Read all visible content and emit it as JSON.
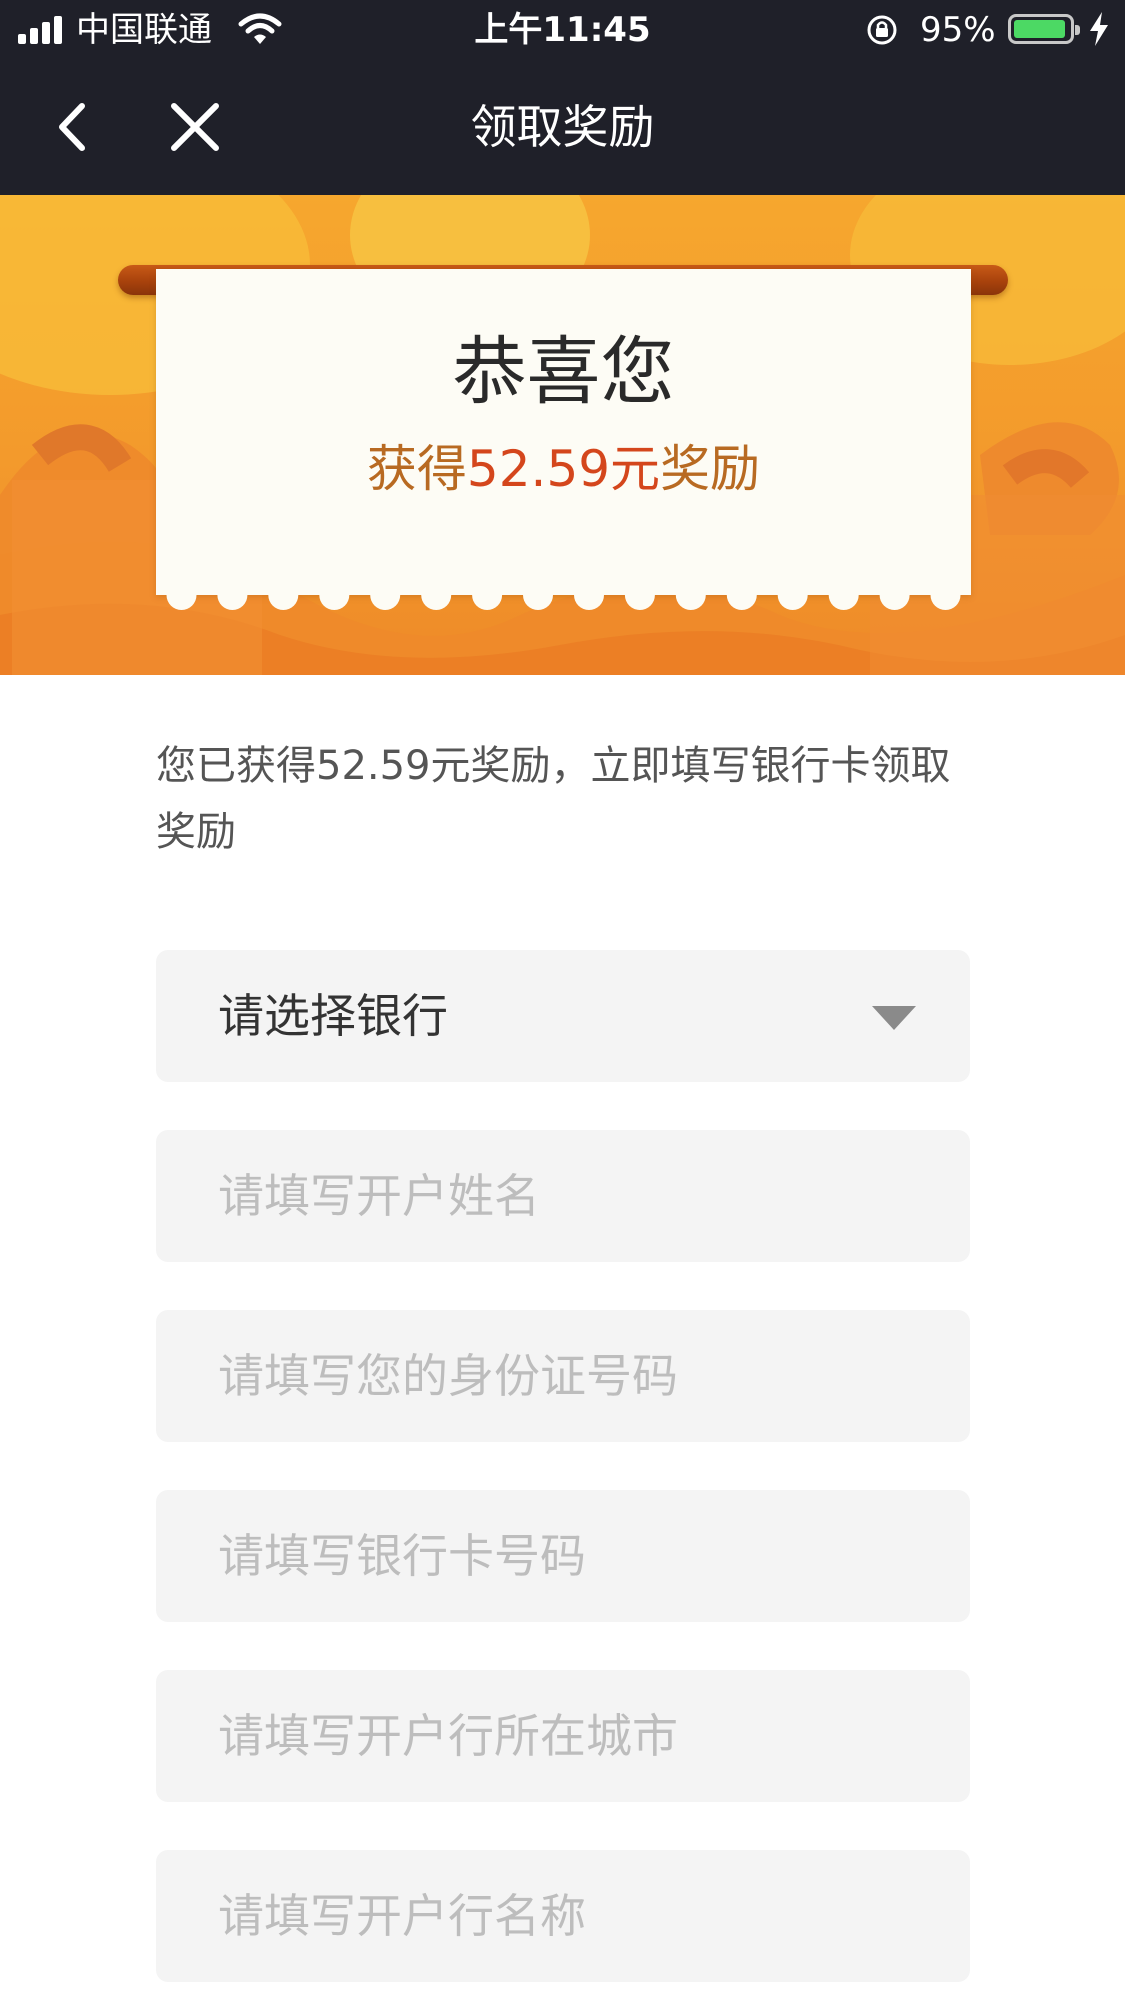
{
  "status_bar": {
    "carrier": "中国联通",
    "time": "上午11:45",
    "battery_percent": "95%",
    "battery_level": 0.95,
    "icons": [
      "signal-icon",
      "wifi-icon",
      "rotation-lock-icon",
      "battery-icon",
      "charging-bolt-icon"
    ]
  },
  "nav": {
    "title": "领取奖励",
    "back_icon": "chevron-left-icon",
    "close_icon": "close-icon"
  },
  "banner": {
    "heading": "恭喜您",
    "reward_prefix": "获得",
    "reward_amount": "52.59元",
    "reward_suffix": "奖励"
  },
  "description": "您已获得52.59元奖励，立即填写银行卡领取奖励",
  "form": {
    "bank_select": {
      "label": "请选择银行",
      "arrow_icon": "dropdown-arrow-icon"
    },
    "name_placeholder": "请填写开户姓名",
    "id_placeholder": "请填写您的身份证号码",
    "card_placeholder": "请填写银行卡号码",
    "city_placeholder": "请填写开户行所在城市",
    "branch_placeholder": "请填写开户行名称"
  },
  "colors": {
    "nav_bg": "#1f2029",
    "banner_orange": "#f39a2c",
    "amount_red": "#d4461c",
    "reward_brown": "#b86a22",
    "field_bg": "#f4f4f4"
  }
}
